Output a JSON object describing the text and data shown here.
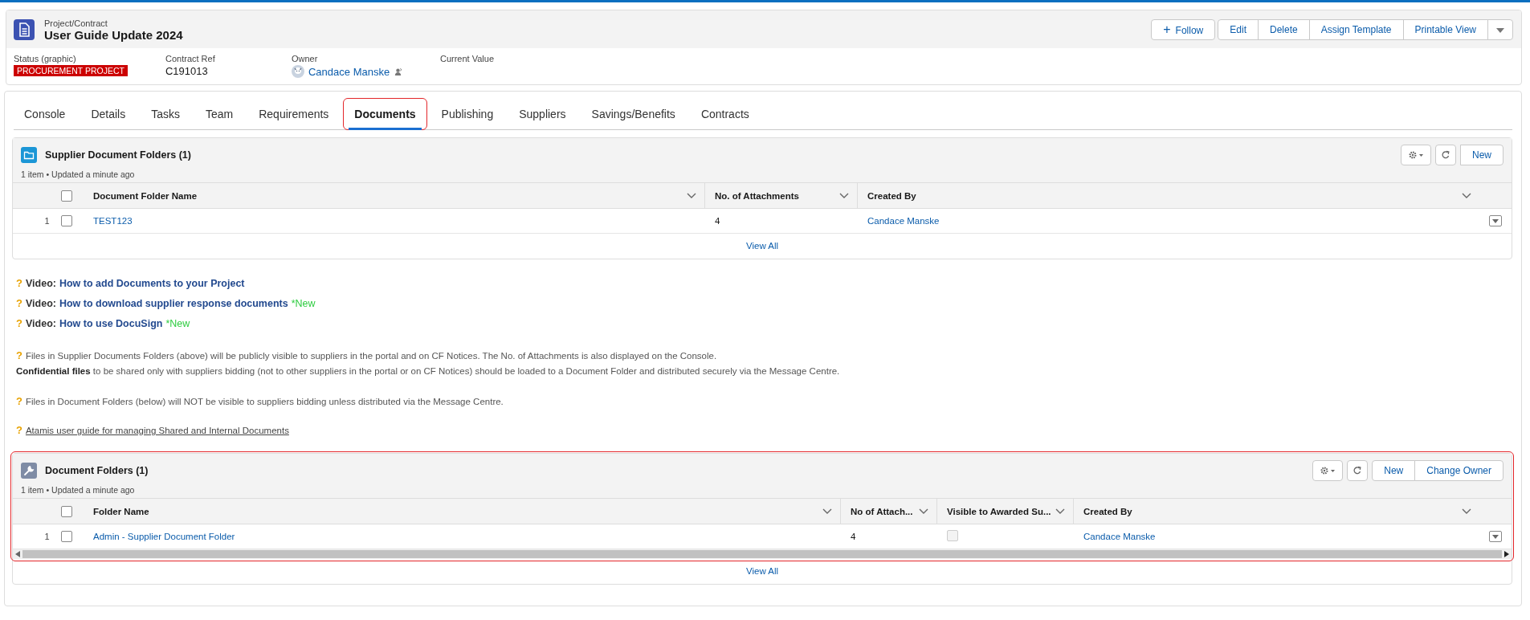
{
  "header": {
    "object_type": "Project/Contract",
    "title": "User Guide Update 2024",
    "actions": [
      {
        "label": "Follow",
        "kind": "follow",
        "symbol": "+"
      },
      {
        "label": "Edit",
        "kind": "plain"
      },
      {
        "label": "Delete",
        "kind": "plain"
      },
      {
        "label": "Assign Template",
        "kind": "plain"
      },
      {
        "label": "Printable View",
        "kind": "plain"
      }
    ],
    "fields": [
      {
        "label": "Status (graphic)",
        "value": "PROCUREMENT PROJECT",
        "kind": "badge"
      },
      {
        "label": "Contract Ref",
        "value": "C191013",
        "kind": "text"
      },
      {
        "label": "Owner",
        "value": "Candace Manske",
        "kind": "user"
      },
      {
        "label": "Current Value",
        "kind": "text"
      }
    ]
  },
  "tabs": [
    {
      "label": "Console",
      "selected": false,
      "highlighted": false
    },
    {
      "label": "Details",
      "selected": false,
      "highlighted": false
    },
    {
      "label": "Tasks",
      "selected": false,
      "highlighted": false
    },
    {
      "label": "Team",
      "selected": false,
      "highlighted": false
    },
    {
      "label": "Requirements",
      "selected": false,
      "highlighted": false
    },
    {
      "label": "Documents",
      "selected": true,
      "highlighted": true
    },
    {
      "label": "Publishing",
      "selected": false,
      "highlighted": false
    },
    {
      "label": "Suppliers",
      "selected": false,
      "highlighted": false
    },
    {
      "label": "Savings/Benefits",
      "selected": false,
      "highlighted": false
    },
    {
      "label": "Contracts",
      "selected": false,
      "highlighted": false
    }
  ],
  "sections": [
    {
      "title": "Supplier Document Folders (1)",
      "meta": "1 item • Updated a minute ago",
      "highlighted": false,
      "horizontal_scroll": false,
      "actions": [
        "New"
      ],
      "columns": [
        "Document Folder Name",
        "No. of Attachments",
        "Created By"
      ],
      "rows": [
        {
          "number": "1",
          "checked": false,
          "cells": [
            {
              "kind": "link",
              "text": "TEST123"
            },
            {
              "kind": "text",
              "text": "4"
            },
            {
              "kind": "link",
              "text": "Candace Manske"
            }
          ]
        }
      ],
      "view_all": "View All"
    },
    {
      "title": "Document Folders (1)",
      "meta": "1 item • Updated a minute ago",
      "highlighted": true,
      "horizontal_scroll": true,
      "actions": [
        "New",
        "Change Owner"
      ],
      "columns": [
        "Folder Name",
        "No of Attach...",
        "Visible to Awarded Su...",
        "Created By"
      ],
      "rows": [
        {
          "number": "1",
          "checked": false,
          "cells": [
            {
              "kind": "link",
              "text": "Admin - Supplier Document Folder"
            },
            {
              "kind": "text",
              "text": "4"
            },
            {
              "kind": "checkbox",
              "checked": false,
              "disabled": true
            },
            {
              "kind": "link",
              "text": "Candace Manske"
            }
          ]
        }
      ],
      "view_all": "View All"
    }
  ],
  "videos": [
    {
      "mark": "?",
      "prefix": "Video:",
      "link": "How to add Documents to your Project"
    },
    {
      "mark": "?",
      "prefix": "Video:",
      "link": "How to download supplier response documents",
      "badge": "*New"
    },
    {
      "mark": "?",
      "prefix": "Video:",
      "link": "How to use DocuSign",
      "badge": "*New"
    }
  ],
  "notes": [
    {
      "mark": "?",
      "kind": "text",
      "lines": [
        "Files in Supplier Documents Folders (above) will be publicly visible to suppliers in the portal and on CF Notices. The No. of Attachments is also displayed on the Console.",
        "**Confidential files** to be shared only with suppliers bidding (not to other suppliers in the portal or on CF Notices) should be loaded to a Document Folder and distributed securely via the Message Centre."
      ]
    },
    {
      "mark": "?",
      "kind": "text",
      "lines": [
        "Files in Document Folders (below) will NOT be visible to suppliers bidding unless distributed via the Message Centre."
      ]
    },
    {
      "mark": "?",
      "kind": "link",
      "lines": [
        "Atamis user guide for managing Shared and Internal Documents"
      ]
    }
  ]
}
